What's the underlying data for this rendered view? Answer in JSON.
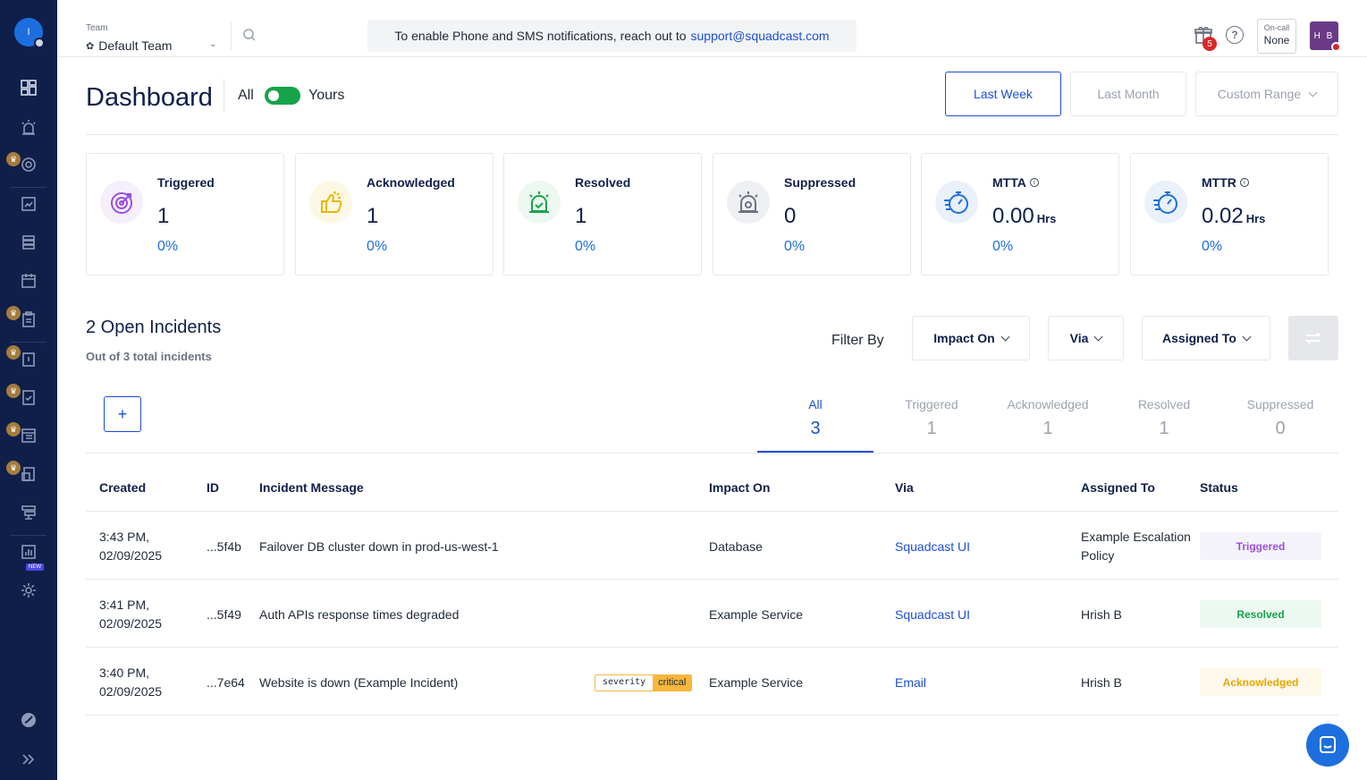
{
  "sidebar": {
    "avatar_initial": "I",
    "items": [
      {
        "icon": "dashboard-icon"
      },
      {
        "icon": "alarm-icon"
      },
      {
        "icon": "target-icon"
      },
      {
        "icon": "analytics-icon"
      },
      {
        "icon": "services-icon"
      },
      {
        "icon": "calendar-icon"
      },
      {
        "icon": "clipboard-icon"
      },
      {
        "icon": "postmortem-icon"
      },
      {
        "icon": "checklist-icon"
      },
      {
        "icon": "status-page-icon"
      },
      {
        "icon": "runbook-icon"
      },
      {
        "icon": "workflow-icon"
      },
      {
        "icon": "reports-icon"
      },
      {
        "icon": "settings-icon"
      }
    ],
    "new_badge": "NEW"
  },
  "topbar": {
    "team_label": "Team",
    "team_value": "Default Team",
    "banner_text": "To enable Phone and SMS notifications, reach out to",
    "banner_link": "support@squadcast.com",
    "gift_count": "5",
    "oncall_label": "On-call",
    "oncall_value": "None",
    "user_initials": "H B"
  },
  "header": {
    "title": "Dashboard",
    "toggle_all": "All",
    "toggle_yours": "Yours",
    "range_last_week": "Last Week",
    "range_last_month": "Last Month",
    "range_custom": "Custom Range"
  },
  "cards": [
    {
      "label": "Triggered",
      "value": "1",
      "unit": "",
      "pct": "0%",
      "color": "#9d4edd"
    },
    {
      "label": "Acknowledged",
      "value": "1",
      "unit": "",
      "pct": "0%",
      "color": "#e6b800"
    },
    {
      "label": "Resolved",
      "value": "1",
      "unit": "",
      "pct": "0%",
      "color": "#16a34a"
    },
    {
      "label": "Suppressed",
      "value": "0",
      "unit": "",
      "pct": "0%",
      "color": "#6b7280"
    },
    {
      "label": "MTTA",
      "value": "0.00",
      "unit": "Hrs",
      "pct": "0%",
      "color": "#1d6fe0"
    },
    {
      "label": "MTTR",
      "value": "0.02",
      "unit": "Hrs",
      "pct": "0%",
      "color": "#1d6fe0"
    }
  ],
  "incidents": {
    "title": "2 Open Incidents",
    "subtitle": "Out of 3 total incidents",
    "filter_by": "Filter By",
    "filters": [
      "Impact On",
      "Via",
      "Assigned To"
    ],
    "add_label": "+",
    "tabs": [
      {
        "label": "All",
        "count": "3"
      },
      {
        "label": "Triggered",
        "count": "1"
      },
      {
        "label": "Acknowledged",
        "count": "1"
      },
      {
        "label": "Resolved",
        "count": "1"
      },
      {
        "label": "Suppressed",
        "count": "0"
      }
    ],
    "columns": [
      "Created",
      "ID",
      "Incident Message",
      "Impact On",
      "Via",
      "Assigned To",
      "Status"
    ],
    "rows": [
      {
        "created_time": "3:43 PM,",
        "created_date": "02/09/2025",
        "id": "...5f4b",
        "message": "Failover DB cluster down in prod-us-west-1",
        "impact": "Database",
        "via": "Squadcast UI",
        "assigned_1": "Example Escalation",
        "assigned_2": "Policy",
        "status": "Triggered"
      },
      {
        "created_time": "3:41 PM,",
        "created_date": "02/09/2025",
        "id": "...5f49",
        "message": "Auth APIs response times degraded",
        "impact": "Example Service",
        "via": "Squadcast UI",
        "assigned_1": "Hrish B",
        "assigned_2": "",
        "status": "Resolved"
      },
      {
        "created_time": "3:40 PM,",
        "created_date": "02/09/2025",
        "id": "...7e64",
        "message": "Website is down (Example Incident)",
        "tag_key": "severity",
        "tag_value": "critical",
        "impact": "Example Service",
        "via": "Email",
        "assigned_1": "Hrish B",
        "assigned_2": "",
        "status": "Acknowledged"
      }
    ]
  }
}
